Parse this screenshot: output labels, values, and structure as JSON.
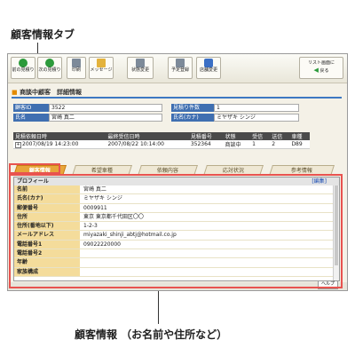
{
  "annotations": {
    "tab_caption": "顧客情報タブ",
    "panel_caption": "顧客情報 （お名前や住所など）"
  },
  "toolbar": {
    "buttons": [
      {
        "label": "前の見積り",
        "icon": "arrow-left-icon"
      },
      {
        "label": "次の見積り",
        "icon": "arrow-right-icon"
      },
      {
        "label": "印刷",
        "icon": "printer-icon"
      },
      {
        "label": "メッセージ",
        "icon": "message-icon"
      },
      {
        "label": "状態変更",
        "icon": "status-icon"
      },
      {
        "label": "予定登録",
        "icon": "calendar-icon"
      },
      {
        "label": "店舗変更",
        "icon": "store-icon"
      }
    ],
    "back_label_1": "リスト画面に",
    "back_label_2": "戻る"
  },
  "detail": {
    "title": "商談中顧客　詳細情報",
    "customer_id_label": "顧客ID",
    "customer_id": "3522",
    "name_label": "氏名",
    "name": "宮崎 真二",
    "estimate_count_label": "見積り件数",
    "estimate_count": "1",
    "kana_label": "氏名(カナ)",
    "kana": "ミヤザキ シンジ"
  },
  "history": {
    "headers": [
      "見積依頼日時",
      "最終受信日時",
      "見積番号",
      "状態",
      "受信",
      "送信",
      "車種"
    ],
    "rows": [
      [
        "2007/08/19 14:23:00",
        "2007/08/22 10:14:00",
        "352364",
        "商談中",
        "1",
        "2",
        "D89"
      ]
    ]
  },
  "tabs": [
    "顧客情報",
    "希望車種",
    "依頼内容",
    "応対状況",
    "参考情報"
  ],
  "profile": {
    "title": "プロフィール",
    "edit_label": "[編集]",
    "fields": [
      {
        "key": "名前",
        "value": "宮崎 真二"
      },
      {
        "key": "氏名(カナ)",
        "value": "ミヤザキ シンジ"
      },
      {
        "key": "郵便番号",
        "value": "0009911"
      },
      {
        "key": "住所",
        "value": "東京 東京都千代田区〇〇"
      },
      {
        "key": "住所(番地以下)",
        "value": "1-2-3"
      },
      {
        "key": "メールアドレス",
        "value": "miyazaki_shinji_abtj@hotmail.co.jp"
      },
      {
        "key": "電話番号1",
        "value": "09022220000"
      },
      {
        "key": "電話番号2",
        "value": ""
      },
      {
        "key": "年齢",
        "value": ""
      },
      {
        "key": "家族構成",
        "value": ""
      }
    ]
  },
  "statusbar": {
    "help_label": "ヘルプ"
  }
}
